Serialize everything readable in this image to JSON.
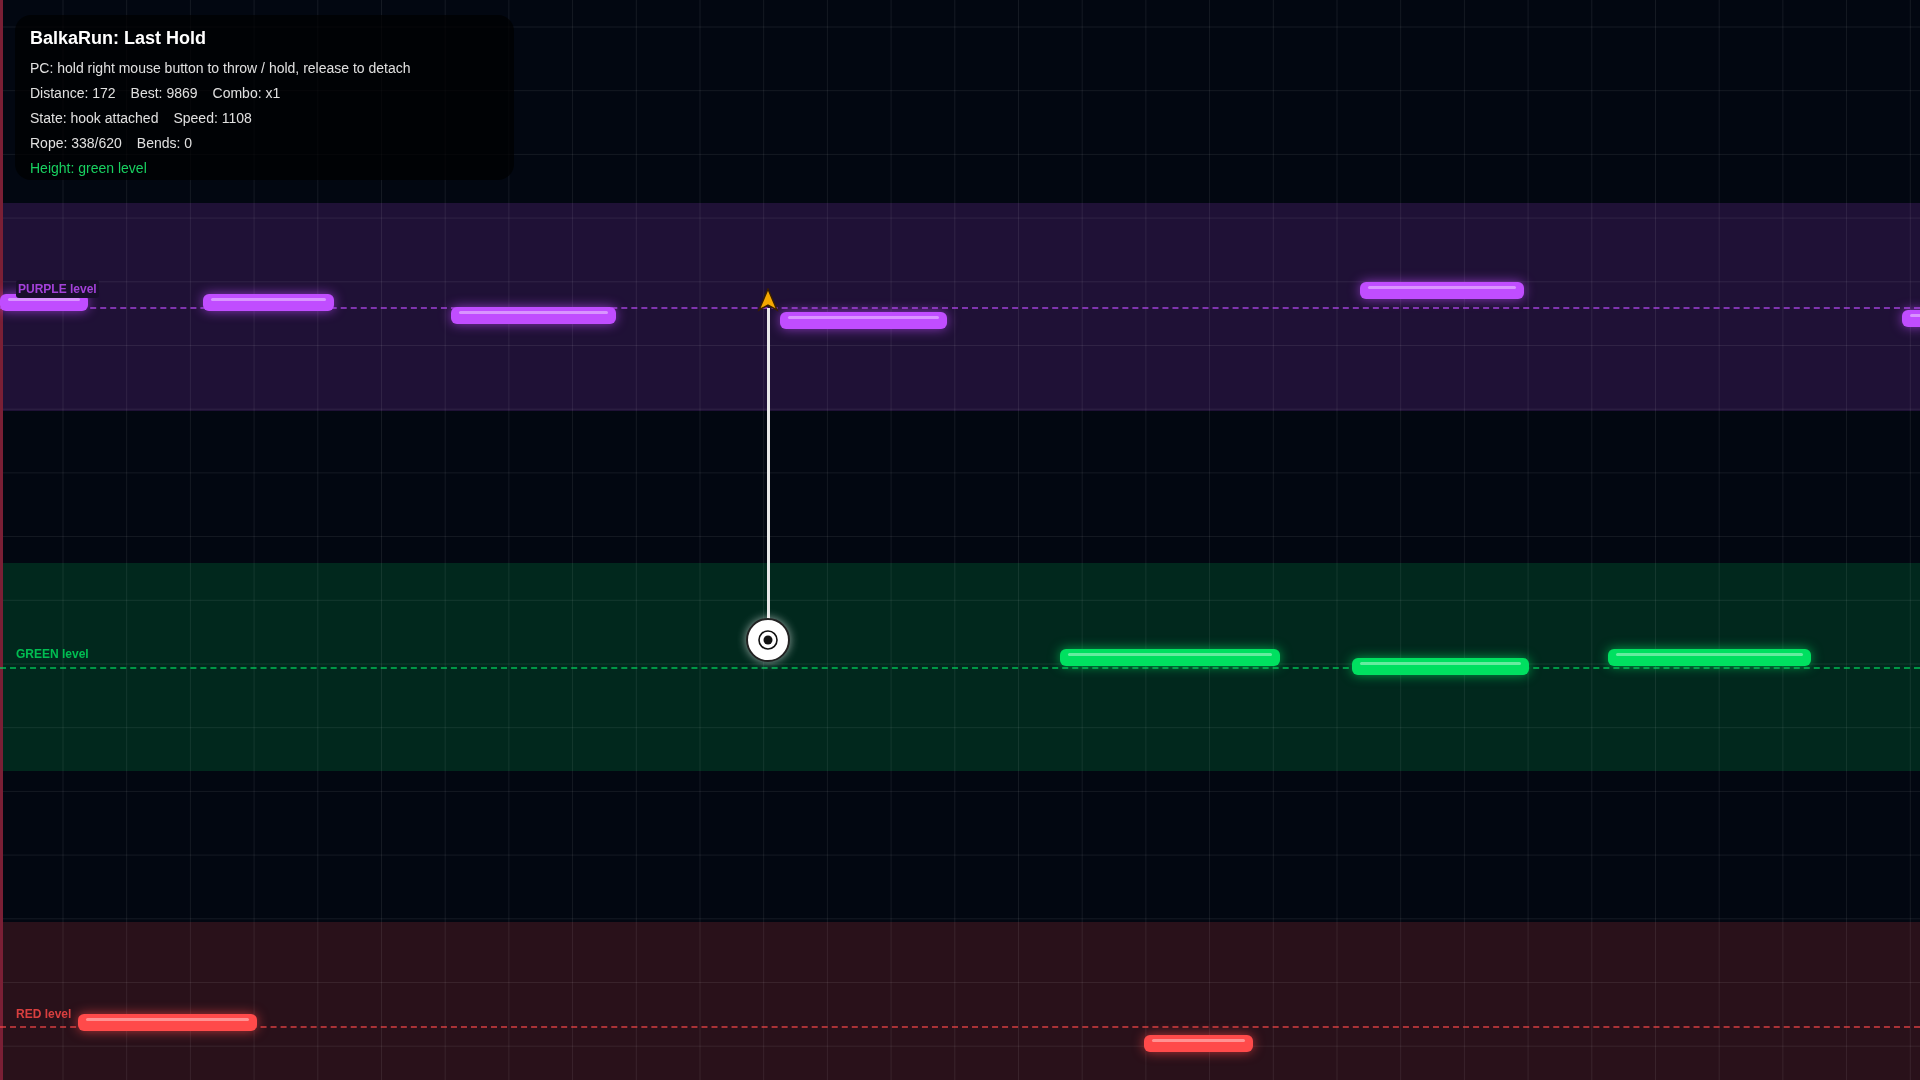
{
  "hud": {
    "title": "BalkaRun: Last Hold",
    "hint": "PC: hold right mouse button to throw / hold, release to detach",
    "stats": [
      [
        "Distance: 172",
        "Best: 9869",
        "Combo: x1"
      ],
      [
        "State: hook attached",
        "Speed: 1108"
      ],
      [
        "Rope: 338/620",
        "Bends: 0"
      ]
    ],
    "height_status": "Height: green level"
  },
  "levels": [
    {
      "label": "PURPLE level",
      "color": "#c04dff"
    },
    {
      "label": "GREEN level",
      "color": "#00e060"
    },
    {
      "label": "RED level",
      "color": "#ff4a4a"
    }
  ]
}
